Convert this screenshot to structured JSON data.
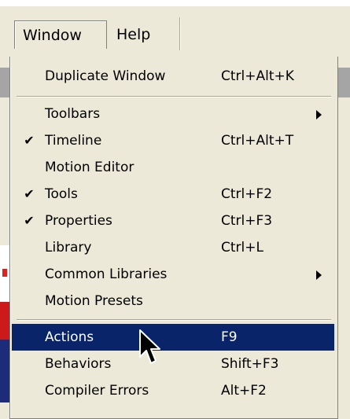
{
  "menubar": {
    "window_label": "Window",
    "help_label": "Help"
  },
  "window_menu": {
    "items": [
      {
        "label": "Duplicate Window",
        "shortcut": "Ctrl+Alt+K",
        "checked": false,
        "submenu": false
      },
      {
        "label": "Toolbars",
        "shortcut": "",
        "checked": false,
        "submenu": true
      },
      {
        "label": "Timeline",
        "shortcut": "Ctrl+Alt+T",
        "checked": true,
        "submenu": false
      },
      {
        "label": "Motion Editor",
        "shortcut": "",
        "checked": false,
        "submenu": false
      },
      {
        "label": "Tools",
        "shortcut": "Ctrl+F2",
        "checked": true,
        "submenu": false
      },
      {
        "label": "Properties",
        "shortcut": "Ctrl+F3",
        "checked": true,
        "submenu": false
      },
      {
        "label": "Library",
        "shortcut": "Ctrl+L",
        "checked": false,
        "submenu": false
      },
      {
        "label": "Common Libraries",
        "shortcut": "",
        "checked": false,
        "submenu": true
      },
      {
        "label": "Motion Presets",
        "shortcut": "",
        "checked": false,
        "submenu": false
      },
      {
        "label": "Actions",
        "shortcut": "F9",
        "checked": false,
        "submenu": false,
        "highlighted": true
      },
      {
        "label": "Behaviors",
        "shortcut": "Shift+F3",
        "checked": false,
        "submenu": false
      },
      {
        "label": "Compiler Errors",
        "shortcut": "Alt+F2",
        "checked": false,
        "submenu": false
      }
    ],
    "check_glyph": "✔"
  },
  "icons": {
    "check": "checkmark-icon",
    "submenu": "submenu-arrow-icon",
    "cursor": "mouse-pointer-icon"
  },
  "colors": {
    "menu_bg": "#ece9d8",
    "highlight_bg": "#0a246a",
    "highlight_text": "#ffffff"
  }
}
